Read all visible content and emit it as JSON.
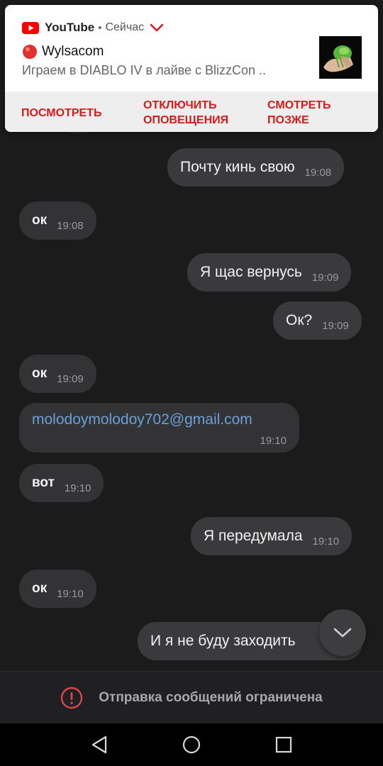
{
  "notification": {
    "app_name": "YouTube",
    "separator": "•",
    "time": "Сейчас",
    "channel": "Wylsacom",
    "body": "Играем в DIABLO IV в лайве с BlizzCon ..",
    "actions": {
      "watch": "ПОСМОТРЕТЬ",
      "disable_line1": "ОТКЛЮЧИТЬ",
      "disable_line2": "ОПОВЕЩЕНИЯ",
      "later_line1": "СМОТРЕТЬ",
      "later_line2": "ПОЗЖЕ"
    },
    "colors": {
      "accent": "#d61a1a",
      "live_dot": "#e03030"
    }
  },
  "messages": [
    {
      "dir": "out",
      "text": "Почту кинь свою",
      "time": "19:08"
    },
    {
      "dir": "in",
      "text": "ок",
      "time": "19:08"
    },
    {
      "dir": "out",
      "text": "Я щас вернусь",
      "time": "19:09"
    },
    {
      "dir": "out",
      "text": "Ок?",
      "time": "19:09"
    },
    {
      "dir": "in",
      "text": "ок",
      "time": "19:09"
    },
    {
      "dir": "in",
      "text": "molodoymolodoy702@gmail.com",
      "time": "19:10"
    },
    {
      "dir": "in",
      "text": "вот",
      "time": "19:10"
    },
    {
      "dir": "out",
      "text": "Я передумала",
      "time": "19:10"
    },
    {
      "dir": "in",
      "text": "ок",
      "time": "19:10"
    },
    {
      "dir": "out",
      "text": "И я не буду заходить",
      "time": ""
    }
  ],
  "restriction": {
    "text": "Отправка сообщений ограничена",
    "icon": "alert-circle-icon",
    "color": "#e0434f"
  },
  "navbar": {
    "back": "back-icon",
    "home": "home-icon",
    "recents": "recents-icon"
  }
}
